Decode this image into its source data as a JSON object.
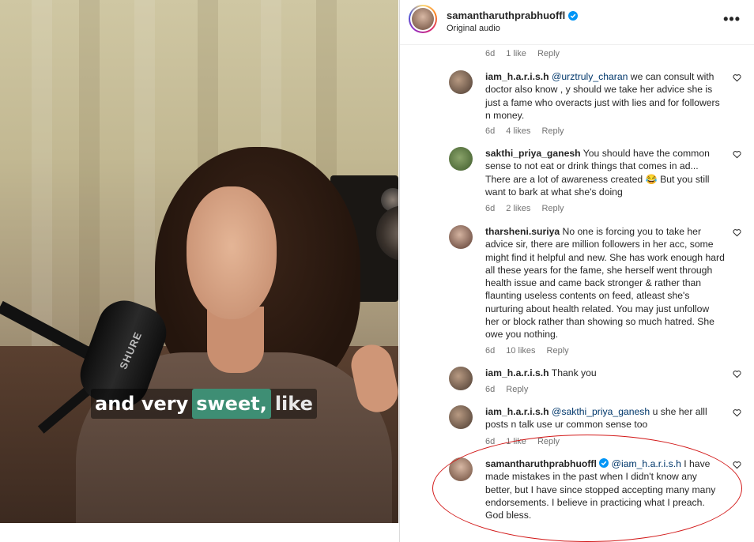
{
  "video": {
    "caption_words": [
      "and very",
      "sweet,",
      "like"
    ],
    "mic_brand": "SHURE",
    "highlight_color": "#3e8e74"
  },
  "header": {
    "username": "samantharuthprabhuoffl",
    "subtitle": "Original audio",
    "more_icon": "more-options-icon"
  },
  "top_meta": {
    "time": "6d",
    "likes": "1 like",
    "reply": "Reply"
  },
  "comments": [
    {
      "user": "iam_h.a.r.i.s.h",
      "mention": "@urztruly_charan",
      "text": " we can consult with doctor also know , y should we take her advice she is just a fame who overacts just with lies and for followers n money.",
      "time": "6d",
      "likes": "4 likes",
      "reply": "Reply"
    },
    {
      "user": "sakthi_priya_ganesh",
      "mention": "",
      "text": " You should have the common sense to not eat or drink things that comes in ad... There are a lot of awareness created 😂 But you still want to bark at what she's doing",
      "time": "6d",
      "likes": "2 likes",
      "reply": "Reply"
    },
    {
      "user": "tharsheni.suriya",
      "mention": "",
      "text": " No one is forcing you to take her advice sir, there are million followers in her acc, some might find it helpful and new. She has work enough hard all these years for the fame, she herself went through health issue and came back stronger & rather than flaunting useless contents on feed, atleast she's nurturing about health related. You may just unfollow her or block rather than showing so much hatred. She owe you nothing.",
      "time": "6d",
      "likes": "10 likes",
      "reply": "Reply"
    },
    {
      "user": "iam_h.a.r.i.s.h",
      "mention": "",
      "text": " Thank you",
      "time": "6d",
      "likes": "",
      "reply": "Reply"
    },
    {
      "user": "iam_h.a.r.i.s.h",
      "mention": "@sakthi_priya_ganesh",
      "text": " u she her alll posts n talk use ur common sense too",
      "time": "6d",
      "likes": "1 like",
      "reply": "Reply"
    },
    {
      "user": "samantharuthprabhuoffl",
      "mention": "@iam_h.a.r.i.s.h",
      "text": " I have made mistakes in the past when I didn't know any better, but I have since stopped accepting many many endorsements. I believe in practicing what I preach. God bless.",
      "time": "",
      "likes": "",
      "reply": ""
    }
  ],
  "colors": {
    "annotation_circle": "#d21818",
    "verified_blue": "#0095f6"
  }
}
